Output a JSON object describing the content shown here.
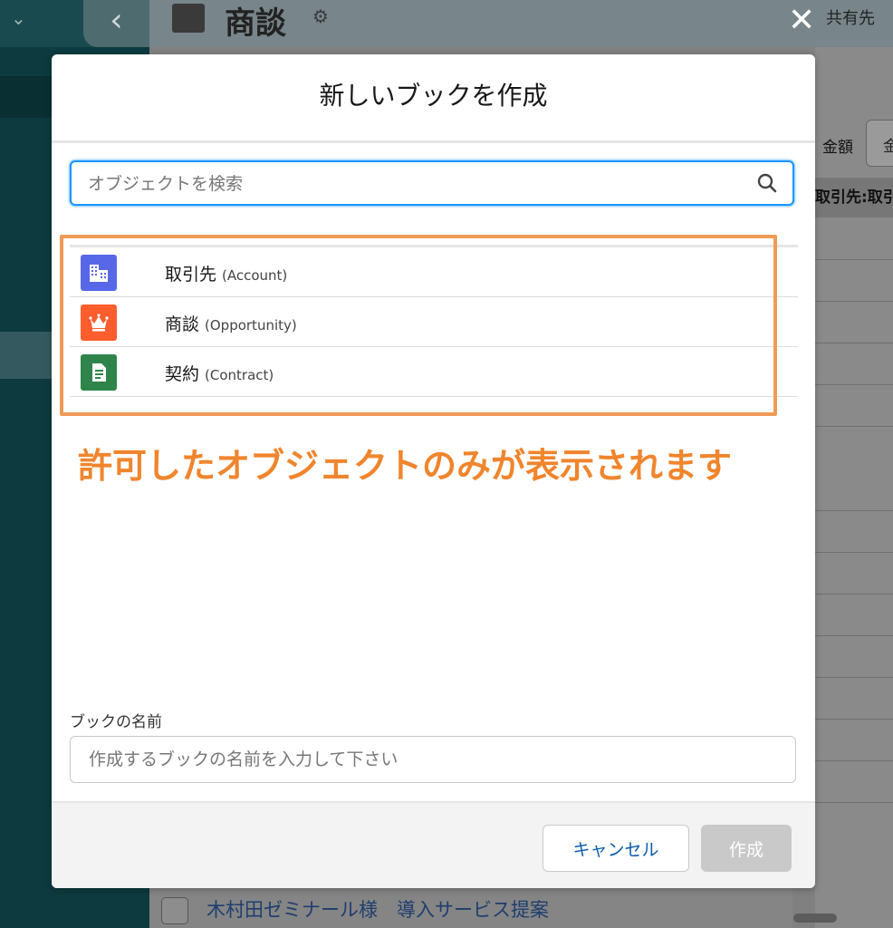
{
  "background": {
    "page_title": "商談",
    "share_label": "共有先",
    "amount_label": "金額",
    "amount_field_text": "金",
    "column_header": "取引先:取引",
    "bottom_row_link": "木村田ゼミナール様　導入サービス提案"
  },
  "modal": {
    "title": "新しいブックを作成",
    "search": {
      "placeholder": "オブジェクトを検索",
      "value": ""
    },
    "objects": [
      {
        "label": "取引先",
        "api_name": "(Account)",
        "icon": "account-building-icon",
        "color": "#5867e8"
      },
      {
        "label": "商談",
        "api_name": "(Opportunity)",
        "icon": "opportunity-crown-icon",
        "color": "#ff5d2d"
      },
      {
        "label": "契約",
        "api_name": "(Contract)",
        "icon": "contract-document-icon",
        "color": "#2e844a"
      }
    ],
    "annotation": "許可したオブジェクトのみが表示されます",
    "book_name": {
      "label": "ブックの名前",
      "placeholder": "作成するブックの名前を入力して下さい",
      "value": ""
    },
    "footer": {
      "cancel_label": "キャンセル",
      "create_label": "作成"
    }
  },
  "colors": {
    "accent_blue": "#1b96ff",
    "annotation_orange": "#f0852d",
    "highlight_border": "#ef9a56",
    "disabled_button": "#c9c9c9"
  }
}
